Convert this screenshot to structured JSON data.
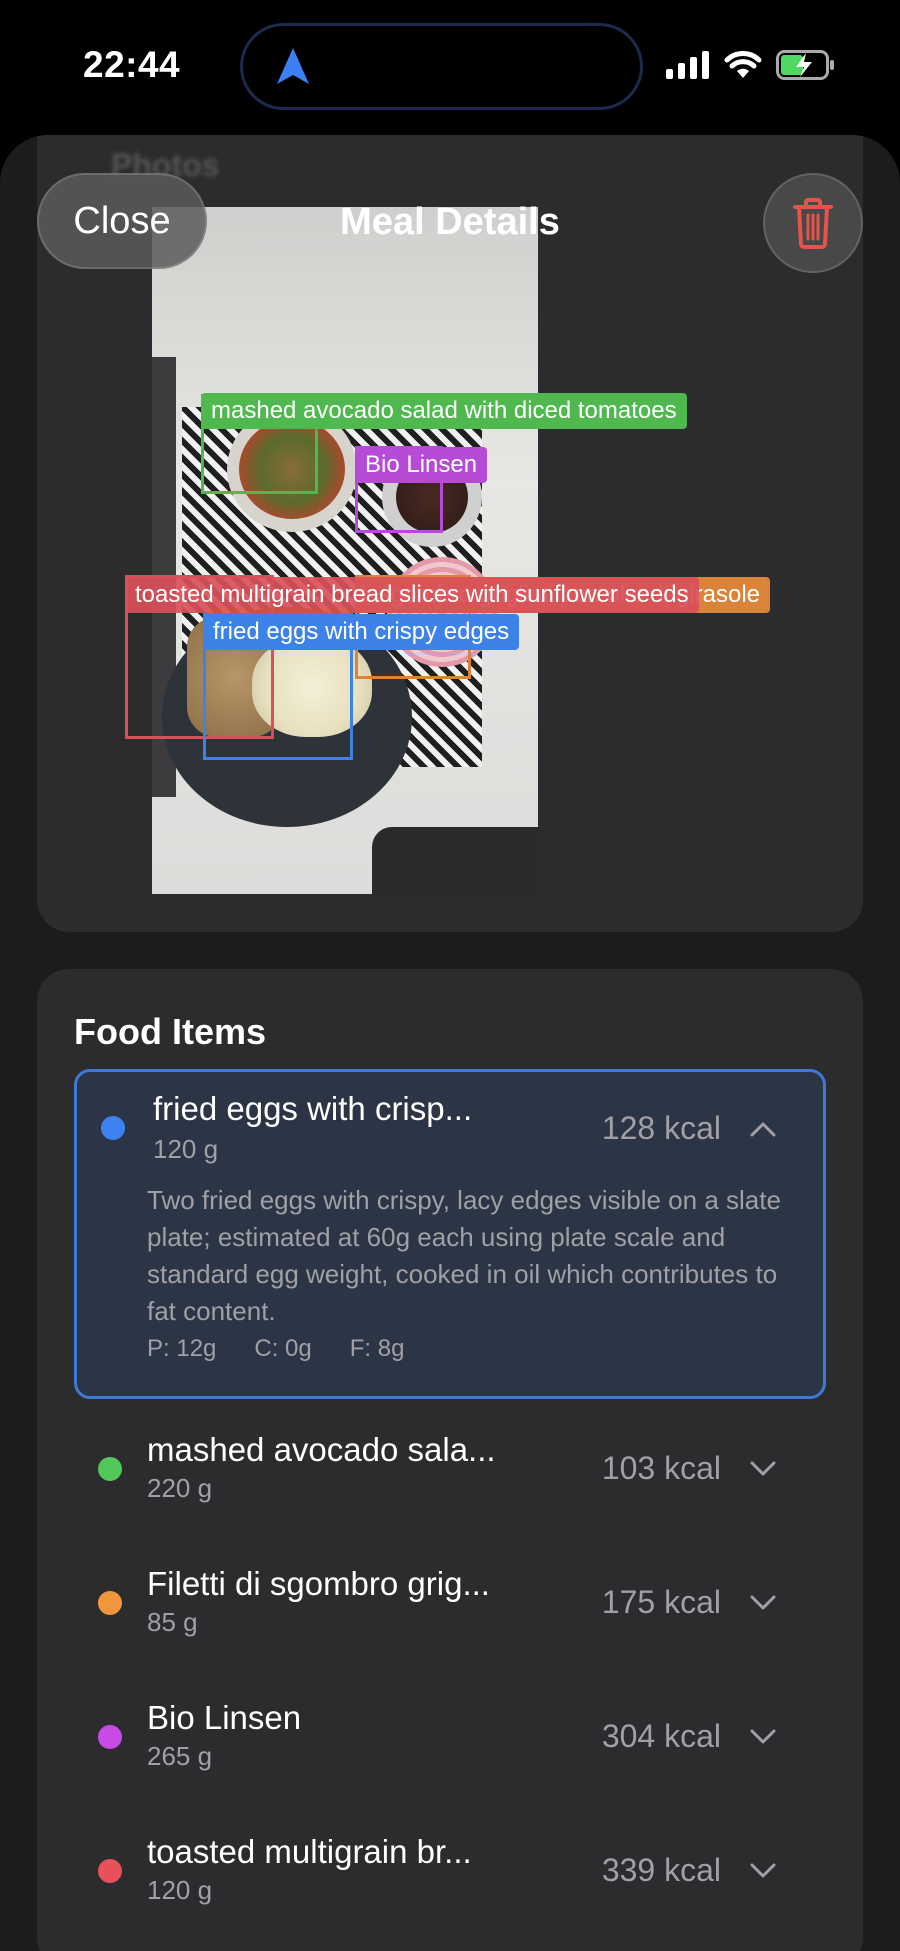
{
  "status_bar": {
    "time": "22:44"
  },
  "header": {
    "title": "Meal Details",
    "close_label": "Close",
    "ghost_title": "Photos"
  },
  "detections": [
    {
      "label": "mashed avocado salad with diced tomatoes",
      "color": "#4fb84f"
    },
    {
      "label": "Bio Linsen",
      "color": "#b54bd6"
    },
    {
      "label": "toasted multigrain bread slices with sunflower seeds",
      "color": "#d9505a"
    },
    {
      "label": "Filetti di sgombro grigliati con olio di girasole",
      "color": "#d9843a"
    },
    {
      "label": "fried eggs with crispy edges",
      "color": "#3d82e6"
    }
  ],
  "food_section": {
    "title": "Food Items",
    "expanded_item": {
      "name": "fried eggs with crisp...",
      "weight": "120 g",
      "kcal": "128 kcal",
      "color": "#3d82f0",
      "description": "Two fried eggs with crispy, lacy edges visible on a slate plate; estimated at 60g each using plate scale and standard egg weight, cooked in oil which contributes to fat content.",
      "protein": "P: 12g",
      "carbs": "C: 0g",
      "fat": "F: 8g"
    },
    "items": [
      {
        "name": "mashed avocado sala...",
        "weight": "220 g",
        "kcal": "103 kcal",
        "color": "#52c85a"
      },
      {
        "name": "Filetti di sgombro grig...",
        "weight": "85 g",
        "kcal": "175 kcal",
        "color": "#f0963c"
      },
      {
        "name": "Bio Linsen",
        "weight": "265 g",
        "kcal": "304 kcal",
        "color": "#c84be6"
      },
      {
        "name": "toasted multigrain br...",
        "weight": "120 g",
        "kcal": "339 kcal",
        "color": "#e8505a"
      }
    ]
  }
}
